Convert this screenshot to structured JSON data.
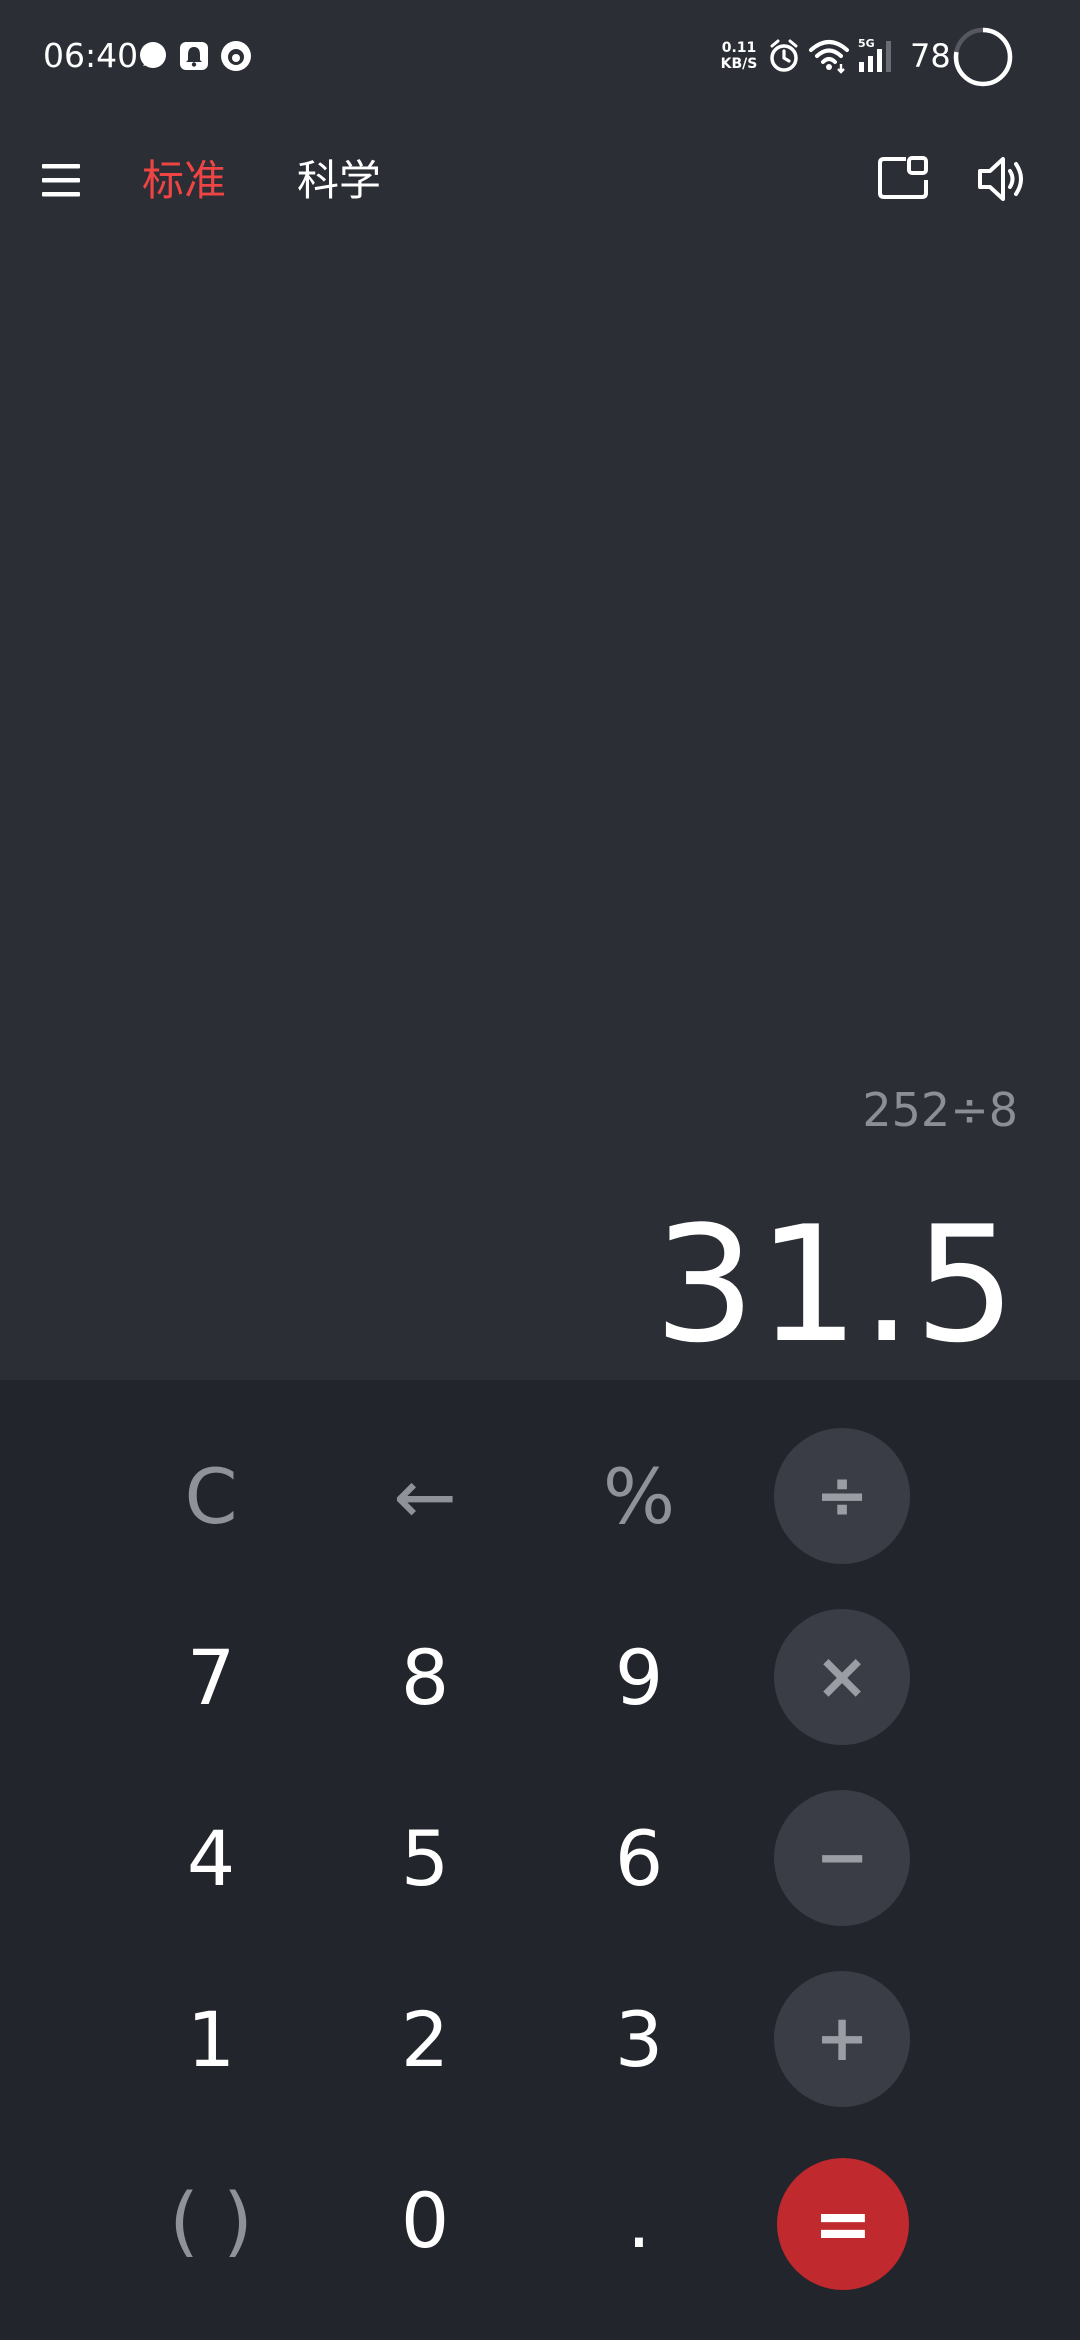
{
  "status_bar": {
    "time": "06:40",
    "net_speed_value": "0.11",
    "net_speed_unit": "KB/S",
    "network_type": "5G",
    "battery": "78",
    "icons": [
      "chat-bubble-icon",
      "bell-icon",
      "app-icon",
      "alarm-icon",
      "wifi-icon",
      "signal-icon",
      "battery-icon"
    ]
  },
  "app_bar": {
    "tabs": [
      {
        "label": "标准",
        "active": true
      },
      {
        "label": "科学",
        "active": false
      }
    ],
    "icons": [
      "menu-icon",
      "mini-window-icon",
      "speaker-icon"
    ]
  },
  "display": {
    "expression": "252÷8",
    "result": "31.5"
  },
  "keypad": {
    "row1": [
      "C",
      "←",
      "%",
      "÷"
    ],
    "row2": [
      "7",
      "8",
      "9",
      "×"
    ],
    "row3": [
      "4",
      "5",
      "6",
      "−"
    ],
    "row4": [
      "1",
      "2",
      "3",
      "+"
    ],
    "row5": [
      "( )",
      "0",
      ".",
      "="
    ]
  },
  "colors": {
    "background": "#2b2e35",
    "keypad_background": "#22252c",
    "accent": "#ee4444",
    "equals_button": "#c0292d",
    "operator_button": "#3a3d45"
  }
}
